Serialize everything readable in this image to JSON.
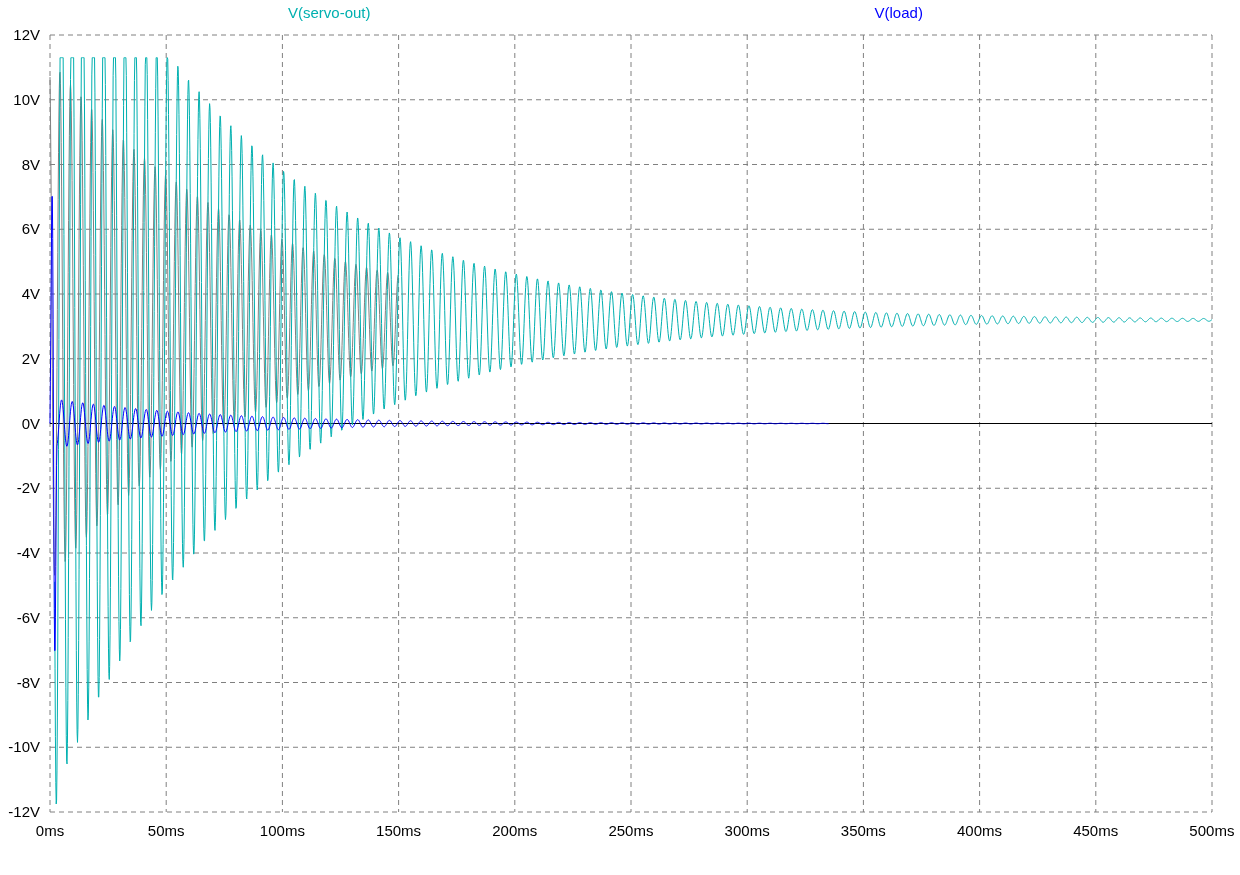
{
  "traces": [
    {
      "label": "V(servo-out)",
      "color": "#00b0b0",
      "kind": "offset"
    },
    {
      "label": "V(load)",
      "color": "#0000ff",
      "kind": "zero"
    }
  ],
  "y_axis": {
    "ticks": [
      "12V",
      "10V",
      "8V",
      "6V",
      "4V",
      "2V",
      "0V",
      "-2V",
      "-4V",
      "-6V",
      "-8V",
      "-10V",
      "-12V"
    ]
  },
  "x_axis": {
    "ticks": [
      "0ms",
      "50ms",
      "100ms",
      "150ms",
      "200ms",
      "250ms",
      "300ms",
      "350ms",
      "400ms",
      "450ms",
      "500ms"
    ]
  }
}
